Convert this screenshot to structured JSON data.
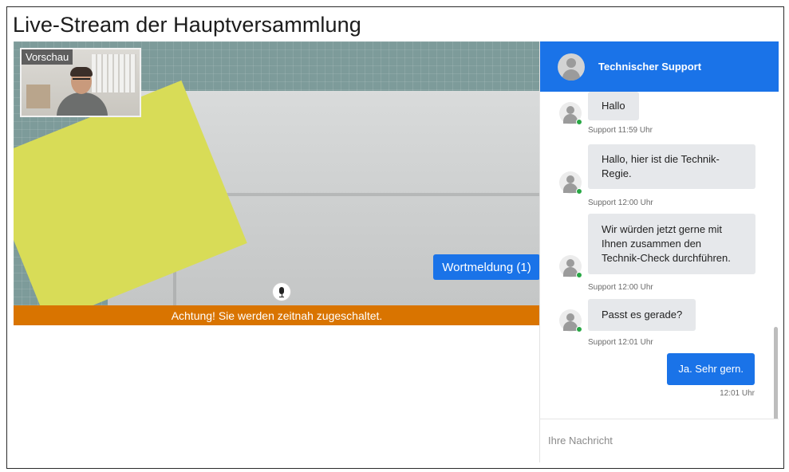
{
  "page": {
    "title": "Live-Stream der Hauptversammlung"
  },
  "video": {
    "preview_label": "Vorschau",
    "request_button": "Wortmeldung (1)",
    "notice": "Achtung! Sie werden zeitnah zugeschaltet."
  },
  "chat": {
    "title": "Technischer Support",
    "messages": [
      {
        "text": "Hallo",
        "meta": "Support 11:59 Uhr",
        "direction": "in"
      },
      {
        "text": "Hallo, hier ist die Technik-Regie.",
        "meta": "Support 12:00 Uhr",
        "direction": "in"
      },
      {
        "text": "Wir würden jetzt gerne mit Ihnen zusammen den Technik-Check durchführen.",
        "meta": "Support 12:00 Uhr",
        "direction": "in"
      },
      {
        "text": "Passt es gerade?",
        "meta": "Support 12:01 Uhr",
        "direction": "in"
      },
      {
        "text": "Ja. Sehr gern.",
        "meta": "12:01 Uhr",
        "direction": "out"
      }
    ],
    "input_placeholder": "Ihre Nachricht"
  },
  "colors": {
    "accent": "#1a73e8",
    "notice": "#d97400",
    "online": "#28a745",
    "bubble_in": "#e6e8eb"
  },
  "icons": [
    "microphone-icon",
    "user-avatar-icon",
    "online-status-icon"
  ]
}
